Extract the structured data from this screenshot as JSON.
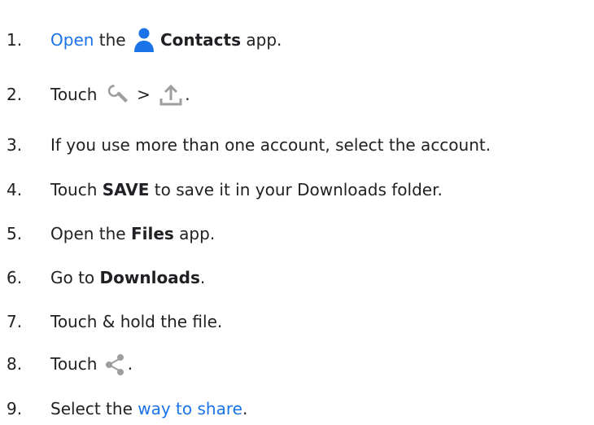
{
  "steps": [
    {
      "number": "1.",
      "parts": [
        "Open",
        " the ",
        "Contacts",
        " app."
      ]
    },
    {
      "number": "2.",
      "parts": [
        "Touch ",
        " > ",
        "."
      ]
    },
    {
      "number": "3.",
      "parts": [
        "If you use more than one account, select the account."
      ]
    },
    {
      "number": "4.",
      "parts": [
        "Touch ",
        "SAVE",
        " to save it in your Downloads folder."
      ]
    },
    {
      "number": "5.",
      "parts": [
        "Open the ",
        "Files",
        " app."
      ]
    },
    {
      "number": "6.",
      "parts": [
        "Go to ",
        "Downloads",
        "."
      ]
    },
    {
      "number": "7.",
      "parts": [
        "Touch & hold the file."
      ]
    },
    {
      "number": "8.",
      "parts": [
        "Touch ",
        "."
      ]
    },
    {
      "number": "9.",
      "parts": [
        "Select the ",
        "way to share",
        "."
      ]
    }
  ],
  "icons": {
    "contacts": "person-icon",
    "settings": "wrench-icon",
    "export": "upload-icon",
    "share": "share-icon"
  },
  "colors": {
    "text": "#202124",
    "link": "#1a73e8",
    "contacts_icon": "#1a73e8",
    "grey_icon": "#9e9e9e"
  }
}
